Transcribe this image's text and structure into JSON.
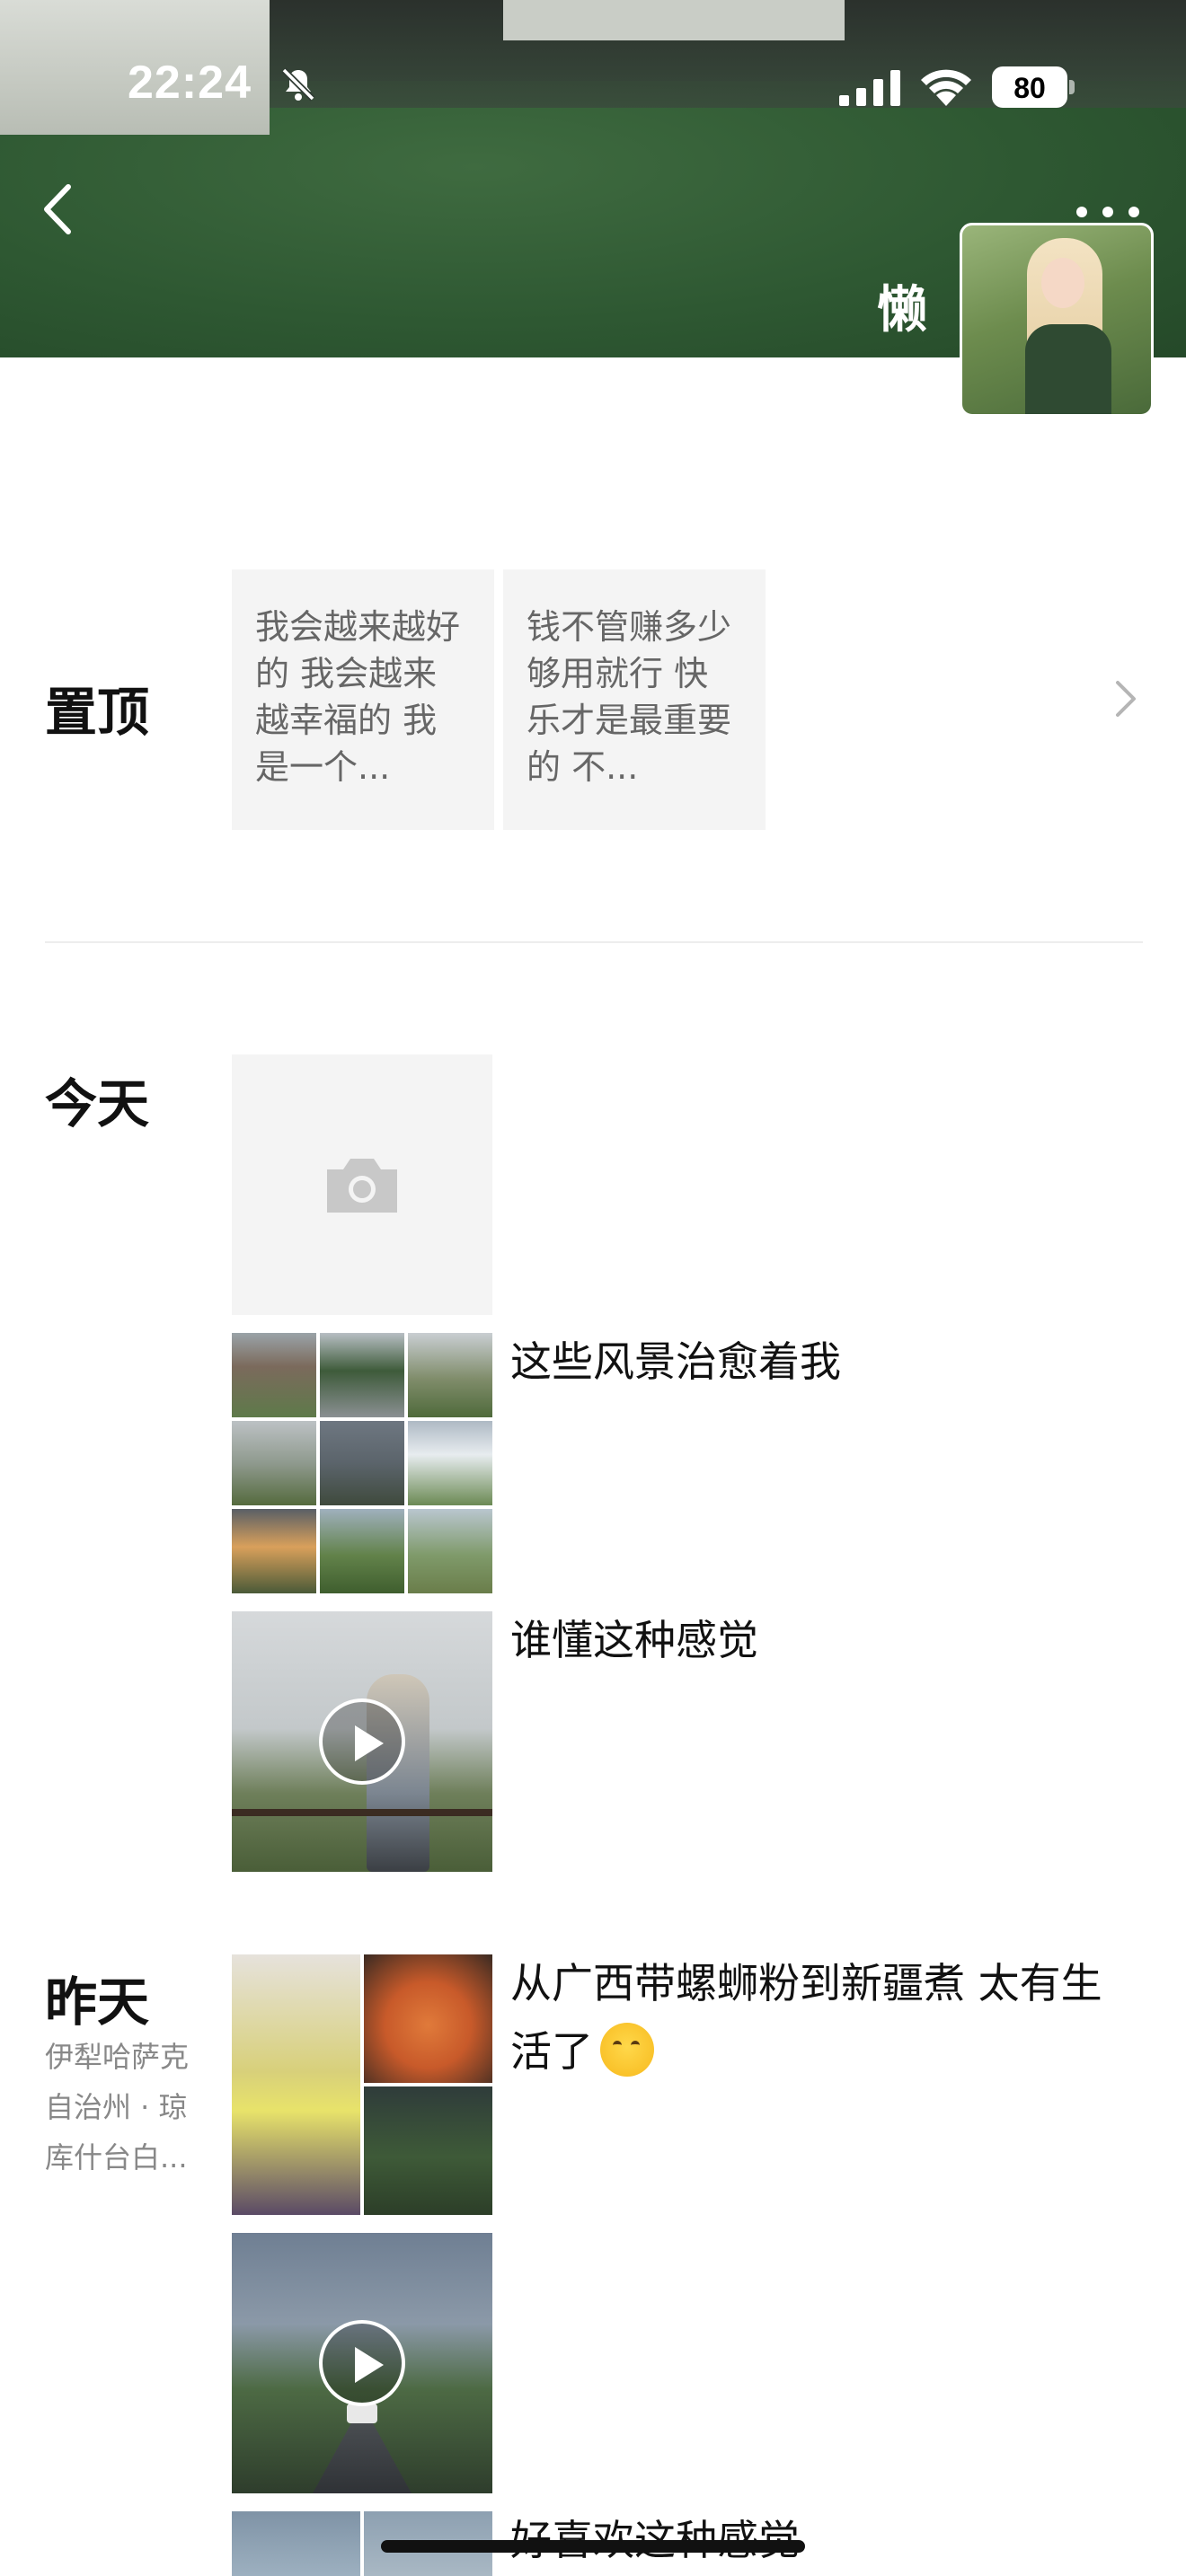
{
  "status_bar": {
    "time": "22:24",
    "battery": "80",
    "icons": [
      "bell-slash-icon",
      "cellular-signal-icon",
      "wifi-icon",
      "battery-icon"
    ]
  },
  "header": {
    "nickname": "懒",
    "back_icon": "chevron-left-icon",
    "more_icon": "more-dots-icon"
  },
  "pinned": {
    "label": "置顶",
    "cards": [
      {
        "text": "我会越来越好的 我会越来越幸福的 我是一个..."
      },
      {
        "text": "钱不管赚多少 够用就行 快乐才是最重要的 不..."
      }
    ]
  },
  "today": {
    "label": "今天",
    "posts": [
      {
        "type": "camera",
        "text": ""
      },
      {
        "type": "photos-9",
        "text": "这些风景治愈着我"
      },
      {
        "type": "video",
        "text": "谁懂这种感觉"
      }
    ]
  },
  "yesterday": {
    "label": "昨天",
    "location": "伊犁哈萨克自治州 · 琼库什台白...",
    "posts": [
      {
        "type": "photos-4",
        "text": "从广西带螺蛳粉到新疆煮 太有生活了",
        "emoji": "drooling-face-emoji"
      },
      {
        "type": "video",
        "text": ""
      },
      {
        "type": "photos-2",
        "text": "好喜欢这种感觉"
      }
    ]
  },
  "colors": {
    "background": "#ffffff",
    "card_bg": "#f4f4f4",
    "secondary_text": "#888888"
  }
}
